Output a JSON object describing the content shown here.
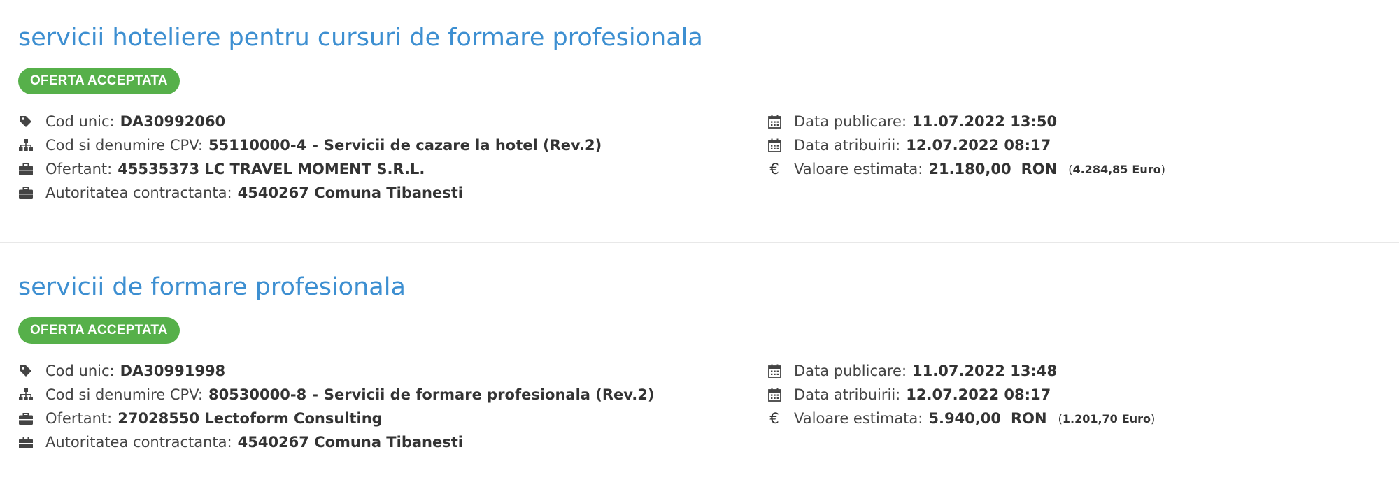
{
  "listings": [
    {
      "title": "servicii hoteliere pentru cursuri de formare profesionala",
      "status": "OFERTA ACCEPTATA",
      "cod_unic_label": "Cod unic:",
      "cod_unic": "DA30992060",
      "cpv_label": "Cod si denumire CPV:",
      "cpv_code": "55110000-4",
      "cpv_separator": "-",
      "cpv_name": "Servicii de cazare la hotel (Rev.2)",
      "ofertant_label": "Ofertant:",
      "ofertant": "45535373 LC TRAVEL MOMENT S.R.L.",
      "autoritate_label": "Autoritatea contractanta:",
      "autoritate": "4540267 Comuna Tibanesti",
      "data_publicare_label": "Data publicare:",
      "data_publicare": "11.07.2022 13:50",
      "data_atribuirii_label": "Data atribuirii:",
      "data_atribuirii": "12.07.2022 08:17",
      "valoare_label": "Valoare estimata:",
      "valoare": "21.180,00",
      "currency": "RON",
      "euro_open": "(",
      "euro_value": "4.284,85",
      "euro_unit": "Euro",
      "euro_close": ")"
    },
    {
      "title": "servicii de formare profesionala",
      "status": "OFERTA ACCEPTATA",
      "cod_unic_label": "Cod unic:",
      "cod_unic": "DA30991998",
      "cpv_label": "Cod si denumire CPV:",
      "cpv_code": "80530000-8",
      "cpv_separator": "-",
      "cpv_name": "Servicii de formare profesionala (Rev.2)",
      "ofertant_label": "Ofertant:",
      "ofertant": "27028550 Lectoform Consulting",
      "autoritate_label": "Autoritatea contractanta:",
      "autoritate": "4540267 Comuna Tibanesti",
      "data_publicare_label": "Data publicare:",
      "data_publicare": "11.07.2022 13:48",
      "data_atribuirii_label": "Data atribuirii:",
      "data_atribuirii": "12.07.2022 08:17",
      "valoare_label": "Valoare estimata:",
      "valoare": "5.940,00",
      "currency": "RON",
      "euro_open": "(",
      "euro_value": "1.201,70",
      "euro_unit": "Euro",
      "euro_close": ")"
    }
  ],
  "icons": {
    "cod_unic": "tag-icon",
    "cpv": "sitemap-icon",
    "ofertant": "briefcase-icon",
    "autoritate": "briefcase-icon",
    "data_publicare": "calendar-icon",
    "data_atribuirii": "calendar-icon",
    "valoare": "euro-icon",
    "euro_glyph": "€"
  },
  "colors": {
    "title": "#3d8fd1",
    "badge_bg": "#56b04a",
    "badge_text": "#ffffff",
    "divider": "#e8e8e8"
  }
}
